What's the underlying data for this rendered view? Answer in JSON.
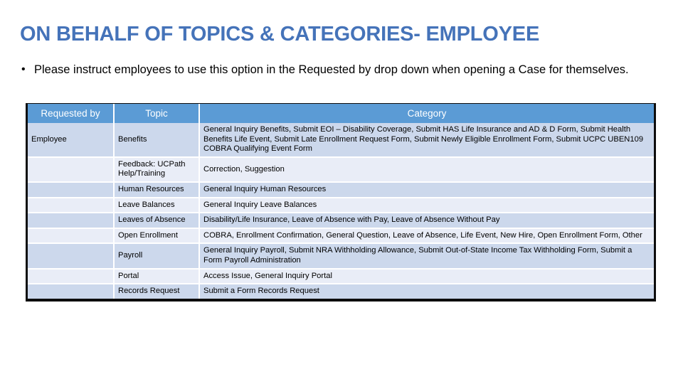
{
  "slide": {
    "title": "ON BEHALF OF TOPICS & CATEGORIES- EMPLOYEE",
    "title_color": "#4573b9",
    "bullets": [
      {
        "marker": "•",
        "text": "Please instruct employees to use this option in the Requested by drop down when opening a Case for themselves."
      }
    ]
  },
  "table": {
    "header_bg": "#5b9bd5",
    "row_odd_bg": "#ccd8ec",
    "row_even_bg": "#e9edf7",
    "columns": [
      {
        "key": "requested_by",
        "label": "Requested by"
      },
      {
        "key": "topic",
        "label": "Topic"
      },
      {
        "key": "category",
        "label": "Category"
      }
    ],
    "rows": [
      {
        "requested_by": "Employee",
        "topic": "Benefits",
        "category": "General Inquiry Benefits, Submit EOI – Disability Coverage, Submit HAS Life Insurance and AD & D Form, Submit Health Benefits Life Event, Submit Late Enrollment Request Form, Submit Newly Eligible Enrollment Form, Submit UCPC UBEN109 COBRA Qualifying Event Form"
      },
      {
        "requested_by": "",
        "topic": "Feedback: UCPath Help/Training",
        "category": "Correction, Suggestion"
      },
      {
        "requested_by": "",
        "topic": "Human Resources",
        "category": "General Inquiry Human Resources"
      },
      {
        "requested_by": "",
        "topic": "Leave Balances",
        "category": "General Inquiry Leave Balances"
      },
      {
        "requested_by": "",
        "topic": "Leaves of Absence",
        "category": "Disability/Life Insurance, Leave of Absence with Pay, Leave of Absence Without Pay"
      },
      {
        "requested_by": "",
        "topic": "Open Enrollment",
        "category": "COBRA, Enrollment Confirmation, General Question, Leave of Absence, Life Event, New Hire, Open Enrollment Form, Other"
      },
      {
        "requested_by": "",
        "topic": "Payroll",
        "category": "General Inquiry Payroll, Submit NRA Withholding Allowance, Submit Out-of-State Income Tax Withholding Form, Submit a Form Payroll Administration"
      },
      {
        "requested_by": "",
        "topic": "Portal",
        "category": "Access Issue, General Inquiry Portal"
      },
      {
        "requested_by": "",
        "topic": "Records Request",
        "category": "Submit a Form Records Request"
      }
    ]
  }
}
